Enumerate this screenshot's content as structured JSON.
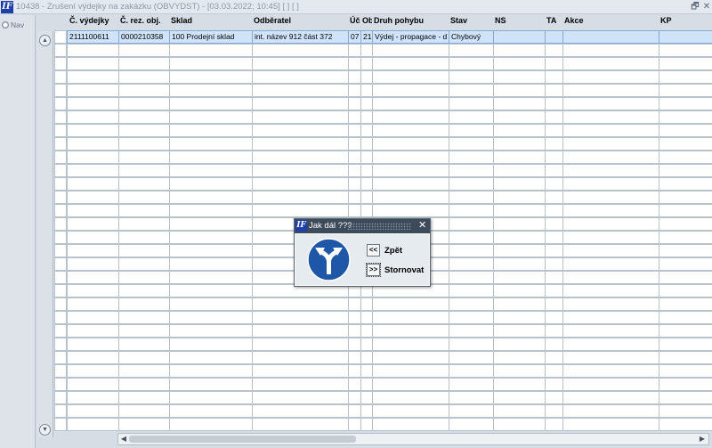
{
  "window": {
    "logo_text": "IF",
    "title": "10438 - Zrušení výdejky na zakázku (OBVYDST) - [03.03.2022; 10:45] [ ] [ ]",
    "restore_glyph": "🗗",
    "close_glyph": "✕"
  },
  "sidebar": {
    "nav_label": "Nav"
  },
  "scroll": {
    "up": "▲",
    "down": "▼",
    "left": "◀",
    "right": "▶"
  },
  "table": {
    "columns": [
      "Č. výdejky",
      "Č. rez. obj.",
      "Sklad",
      "Odběratel",
      "Úč.",
      "Ob",
      "Druh pohybu",
      "Stav",
      "NS",
      "TA",
      "Akce",
      "KP"
    ],
    "selected_row": [
      "2111100611",
      "0000210358",
      "100 Prodejní sklad",
      "int. název 912 část 372",
      "07",
      "21",
      "Výdej - propagace - d",
      "Chybový",
      "",
      "",
      "",
      ""
    ]
  },
  "dialog": {
    "logo_text": "IF",
    "title": "Jak dál ???",
    "close_glyph": "✕",
    "back_glyph": "<<",
    "back_label": "Zpět",
    "cancel_glyph": ">>",
    "cancel_label": "Stornovat",
    "sign_color": "#1e57a8"
  }
}
